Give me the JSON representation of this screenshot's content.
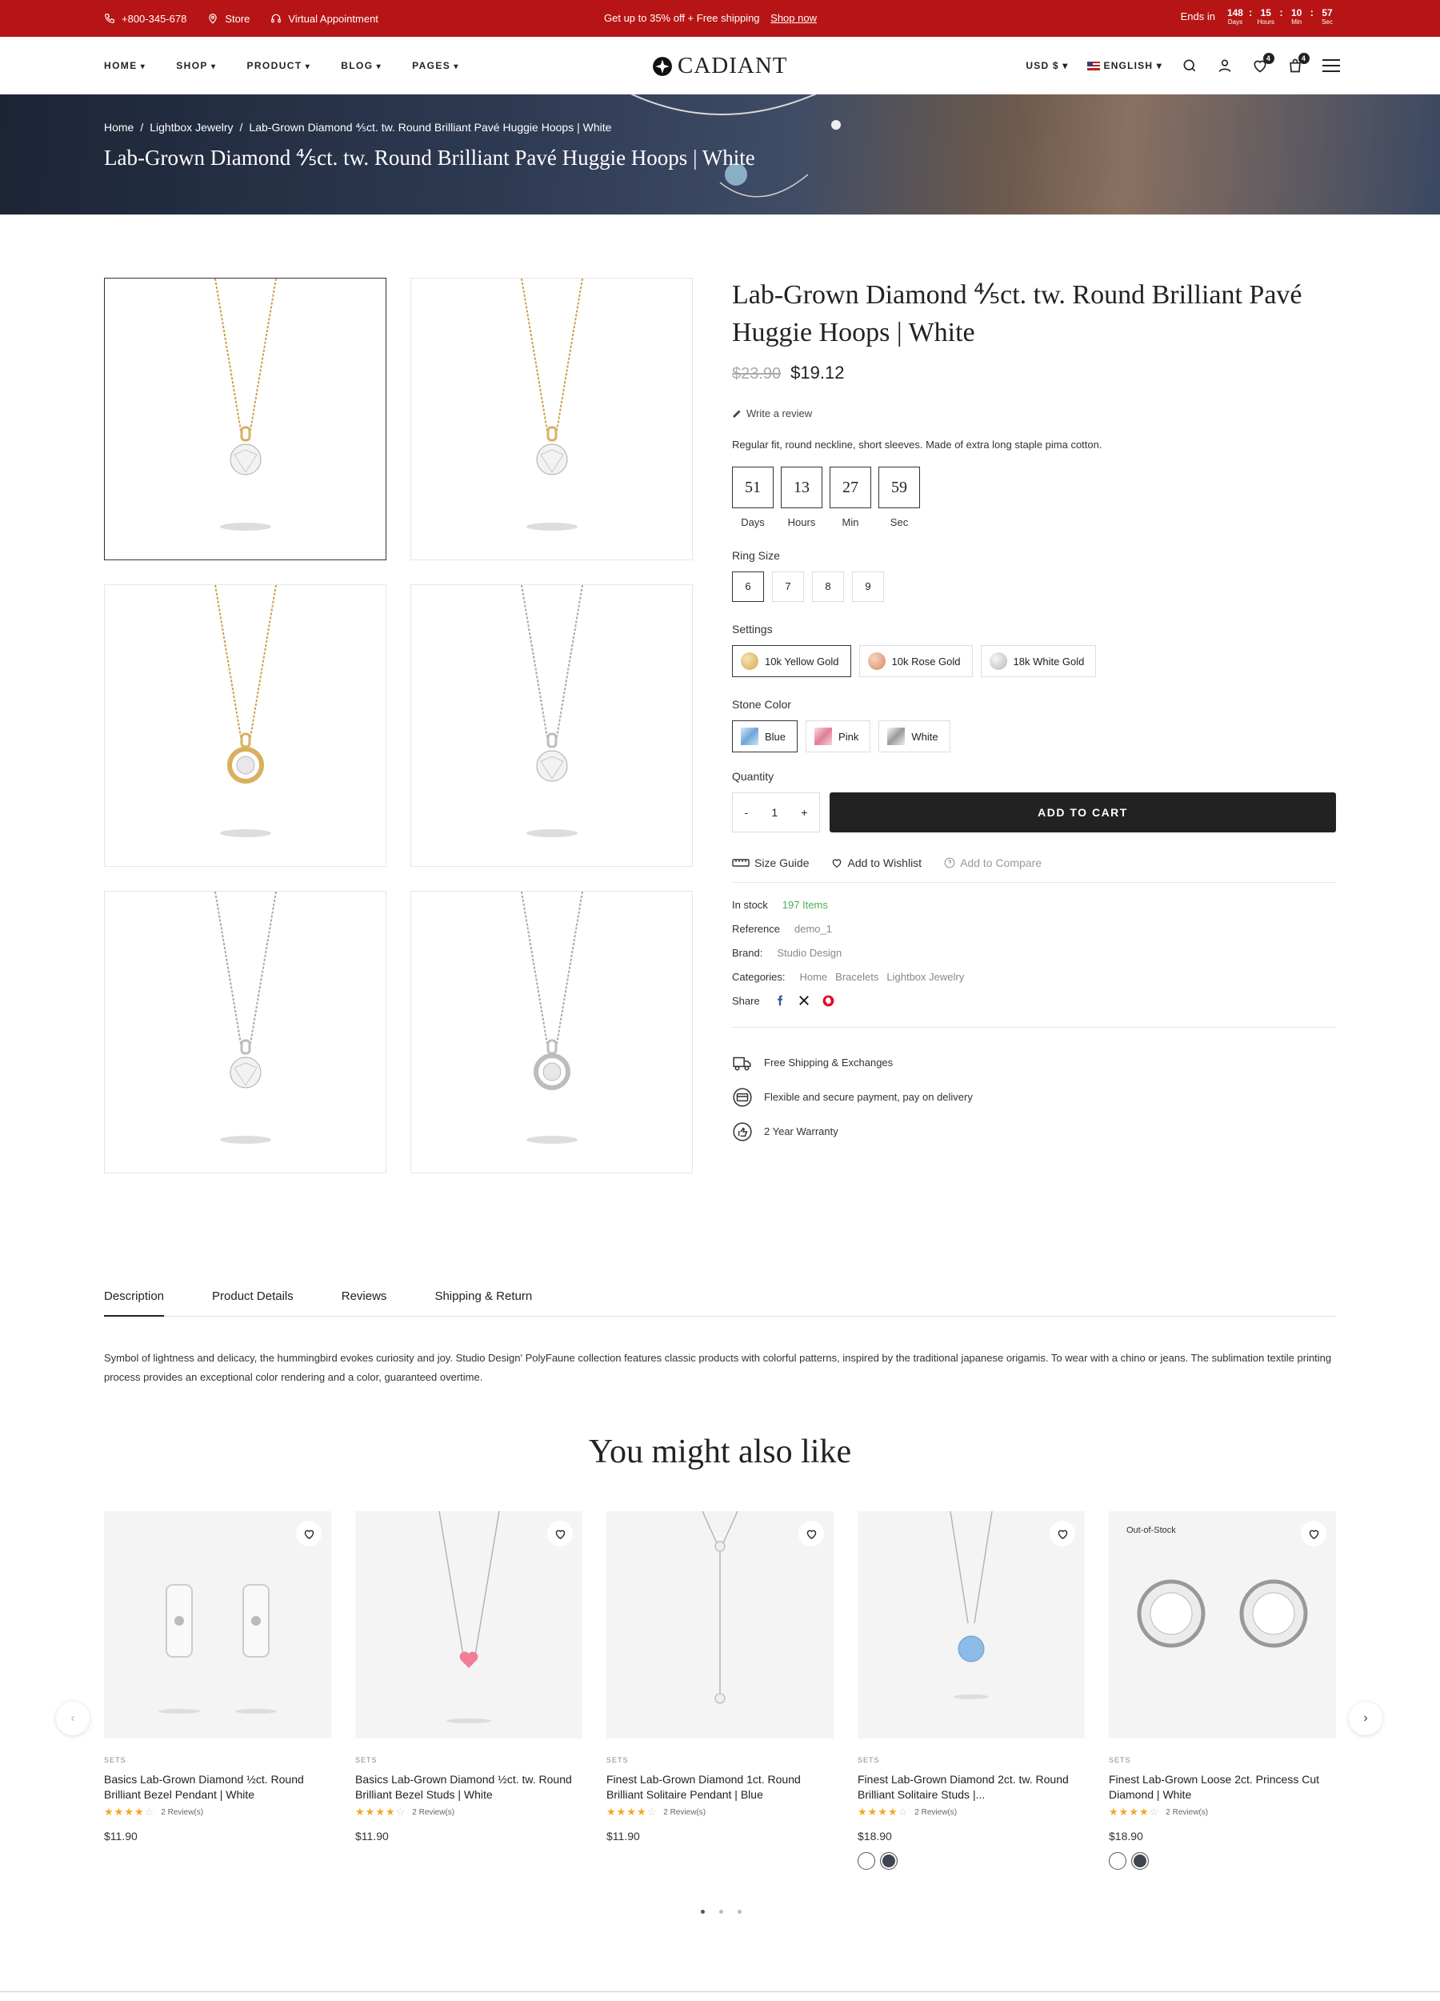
{
  "topbar": {
    "phone": "+800-345-678",
    "store": "Store",
    "appointment": "Virtual Appointment",
    "promo": "Get up to 35% off + Free shipping",
    "promo_link": "Shop now",
    "ends_label": "Ends in",
    "countdown": [
      {
        "value": "148",
        "unit": "Days"
      },
      {
        "value": "15",
        "unit": "Hours"
      },
      {
        "value": "10",
        "unit": "Min"
      },
      {
        "value": "57",
        "unit": "Sec"
      }
    ],
    "bg_color": "#b71515"
  },
  "nav": {
    "items": [
      "HOME",
      "SHOP",
      "PRODUCT",
      "BLOG",
      "PAGES"
    ],
    "logo": "CADIANT",
    "currency": "USD $",
    "language": "ENGLISH",
    "wishlist_count": "4",
    "cart_count": "4"
  },
  "hero": {
    "breadcrumb": [
      "Home",
      "Lightbox Jewelry",
      "Lab-Grown Diamond ⅘ct. tw. Round Brilliant Pavé Huggie Hoops | White"
    ],
    "title": "Lab-Grown Diamond ⅘ct. tw. Round Brilliant Pavé Huggie Hoops | White"
  },
  "gallery": [
    {
      "metal": "gold",
      "style": "prong"
    },
    {
      "metal": "gold",
      "style": "prong-side"
    },
    {
      "metal": "gold",
      "style": "bezel"
    },
    {
      "metal": "silver",
      "style": "prong"
    },
    {
      "metal": "silver",
      "style": "prong-side"
    },
    {
      "metal": "silver",
      "style": "bezel"
    }
  ],
  "product": {
    "title": "Lab-Grown Diamond ⅘ct. tw. Round Brilliant Pavé Huggie Hoops | White",
    "old_price": "$23.90",
    "price": "$19.12",
    "write_review": "Write a review",
    "description": "Regular fit, round neckline, short sleeves. Made of extra long staple pima cotton.",
    "countdown": [
      {
        "value": "51",
        "unit": "Days"
      },
      {
        "value": "13",
        "unit": "Hours"
      },
      {
        "value": "27",
        "unit": "Min"
      },
      {
        "value": "59",
        "unit": "Sec"
      }
    ],
    "ring_size_label": "Ring Size",
    "ring_sizes": [
      "6",
      "7",
      "8",
      "9"
    ],
    "ring_size_selected": "6",
    "settings_label": "Settings",
    "settings": [
      {
        "label": "10k Yellow Gold",
        "color": "#e2c07a"
      },
      {
        "label": "10k Rose Gold",
        "color": "#e5a585"
      },
      {
        "label": "18k White Gold",
        "color": "#d6d6d6"
      }
    ],
    "stone_label": "Stone Color",
    "stones": [
      {
        "label": "Blue",
        "color": "#9ec4e8"
      },
      {
        "label": "Pink",
        "color": "#eaa0b0"
      },
      {
        "label": "White",
        "color": "#d8d8d8"
      }
    ],
    "quantity_label": "Quantity",
    "quantity": "1",
    "add_to_cart": "ADD TO CART",
    "size_guide": "Size Guide",
    "add_wishlist": "Add to Wishlist",
    "add_compare": "Add to Compare",
    "meta": {
      "stock_label": "In stock",
      "stock_value": "197 Items",
      "ref_label": "Reference",
      "ref_value": "demo_1",
      "brand_label": "Brand:",
      "brand_value": "Studio Design",
      "cat_label": "Categories:",
      "categories": [
        "Home",
        "Bracelets",
        "Lightbox Jewelry"
      ],
      "share_label": "Share"
    },
    "features": [
      "Free Shipping & Exchanges",
      "Flexible and secure payment, pay on delivery",
      "2 Year Warranty"
    ]
  },
  "tabs": {
    "items": [
      "Description",
      "Product Details",
      "Reviews",
      "Shipping & Return"
    ],
    "active": "Description",
    "content": "Symbol of lightness and delicacy, the hummingbird evokes curiosity and joy. Studio Design' PolyFaune collection features classic products with colorful patterns, inspired by the traditional japanese origamis. To wear with a chino or jeans. The sublimation textile printing process provides an exceptional color rendering and a color, guaranteed overtime."
  },
  "related": {
    "title": "You might also like",
    "products": [
      {
        "category": "SETS",
        "name": "Basics Lab-Grown Diamond ½ct. Round Brilliant Bezel Pendant | White",
        "reviews": "2 Review(s)",
        "price": "$11.90",
        "image": "huggie-earrings"
      },
      {
        "category": "SETS",
        "name": "Basics Lab-Grown Diamond ½ct. tw. Round Brilliant Bezel Studs | White",
        "reviews": "2 Review(s)",
        "price": "$11.90",
        "image": "pink-heart-necklace"
      },
      {
        "category": "SETS",
        "name": "Finest Lab-Grown Diamond 1ct. Round Brilliant Solitaire Pendant | Blue",
        "reviews": "2 Review(s)",
        "price": "$11.90",
        "image": "lariat-necklace"
      },
      {
        "category": "SETS",
        "name": "Finest Lab-Grown Diamond 2ct. tw. Round Brilliant Solitaire Studs |...",
        "reviews": "2 Review(s)",
        "price": "$18.90",
        "image": "blue-pendant"
      },
      {
        "category": "SETS",
        "name": "Finest Lab-Grown Loose 2ct. Princess Cut Diamond | White",
        "reviews": "2 Review(s)",
        "price": "$18.90",
        "image": "bezel-studs",
        "badge": "Out-of-Stock"
      }
    ]
  }
}
